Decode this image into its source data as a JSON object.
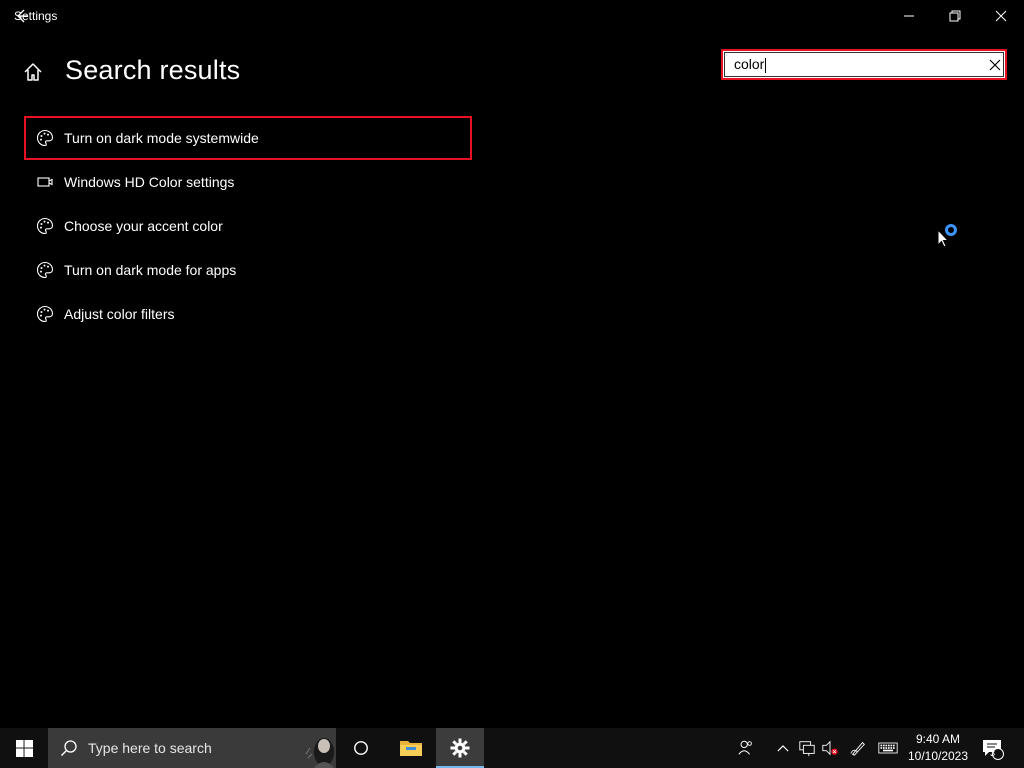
{
  "window": {
    "title": "Settings"
  },
  "header": {
    "title": "Search results"
  },
  "search": {
    "value": "color",
    "placeholder": ""
  },
  "results": [
    {
      "label": "Turn on dark mode systemwide",
      "icon": "palette-icon",
      "selected": true
    },
    {
      "label": "Windows HD Color settings",
      "icon": "display-icon",
      "selected": false
    },
    {
      "label": "Choose your accent color",
      "icon": "palette-icon",
      "selected": false
    },
    {
      "label": "Turn on dark mode for apps",
      "icon": "palette-icon",
      "selected": false
    },
    {
      "label": "Adjust color filters",
      "icon": "palette-icon",
      "selected": false
    }
  ],
  "taskbar": {
    "search_placeholder": "Type here to search",
    "time": "9:40 AM",
    "date": "10/10/2023",
    "notification_count": "3"
  },
  "colors": {
    "highlight": "#e81123",
    "accent": "#76b9ed",
    "busy": "#3a95ff"
  }
}
